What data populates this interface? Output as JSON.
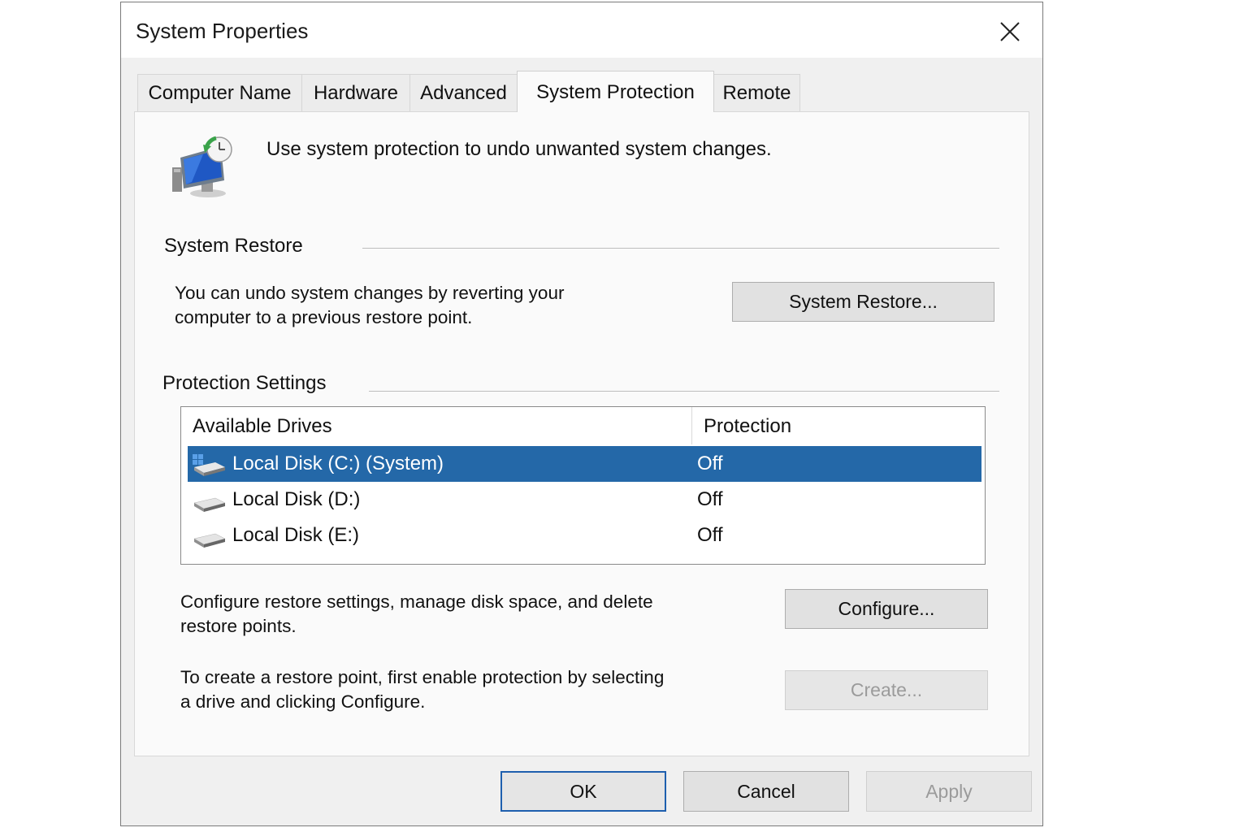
{
  "window": {
    "title": "System Properties"
  },
  "tabs": [
    {
      "label": "Computer Name"
    },
    {
      "label": "Hardware"
    },
    {
      "label": "Advanced"
    },
    {
      "label": "System Protection"
    },
    {
      "label": "Remote"
    }
  ],
  "active_tab": "System Protection",
  "intro": "Use system protection to undo unwanted system changes.",
  "system_restore": {
    "heading": "System Restore",
    "description_line1": "You can undo system changes by reverting your",
    "description_line2": "computer to a previous restore point.",
    "button": "System Restore..."
  },
  "protection_settings": {
    "heading": "Protection Settings",
    "columns": [
      "Available Drives",
      "Protection"
    ],
    "drives": [
      {
        "name": "Local Disk (C:) (System)",
        "protection": "Off",
        "selected": true,
        "icon": "system-drive-icon"
      },
      {
        "name": "Local Disk (D:)",
        "protection": "Off",
        "selected": false,
        "icon": "drive-icon"
      },
      {
        "name": "Local Disk (E:)",
        "protection": "Off",
        "selected": false,
        "icon": "drive-icon"
      }
    ],
    "configure_text_line1": "Configure restore settings, manage disk space, and delete",
    "configure_text_line2": "restore points.",
    "configure_button": "Configure...",
    "create_text_line1": "To create a restore point, first enable protection by selecting",
    "create_text_line2": "a drive and clicking Configure.",
    "create_button": "Create..."
  },
  "footer": {
    "ok": "OK",
    "cancel": "Cancel",
    "apply": "Apply"
  },
  "colors": {
    "selection": "#2468a8",
    "default_button_border": "#1e5fae"
  }
}
